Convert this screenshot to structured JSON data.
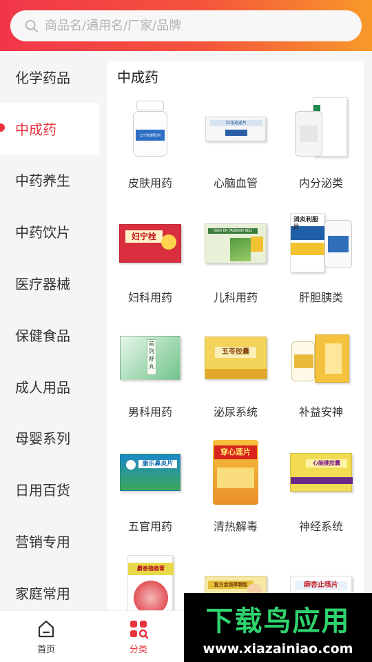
{
  "search": {
    "placeholder": "商品名/通用名/厂家/品牌"
  },
  "sidebar": {
    "items": [
      {
        "label": "化学药品",
        "active": false
      },
      {
        "label": "中成药",
        "active": true
      },
      {
        "label": "中药养生",
        "active": false
      },
      {
        "label": "中药饮片",
        "active": false
      },
      {
        "label": "医疗器械",
        "active": false
      },
      {
        "label": "保健食品",
        "active": false
      },
      {
        "label": "成人用品",
        "active": false
      },
      {
        "label": "母婴系列",
        "active": false
      },
      {
        "label": "日用百货",
        "active": false
      },
      {
        "label": "营销专用",
        "active": false
      },
      {
        "label": "家庭常用",
        "active": false
      }
    ]
  },
  "content": {
    "title": "中成药",
    "categories": [
      {
        "label": "皮肤用药",
        "image_text": "辽宁蛇胆酊剂"
      },
      {
        "label": "心脑血管",
        "image_text": "红花逍遥片"
      },
      {
        "label": "内分泌类",
        "image_text": ""
      },
      {
        "label": "妇科用药",
        "image_text": "妇宁栓"
      },
      {
        "label": "儿科用药",
        "image_text": "XIAO ER YANBIAN KELI"
      },
      {
        "label": "肝胆胰类",
        "image_text": "消炎利胆片"
      },
      {
        "label": "男科用药",
        "image_text": "前列舒丸"
      },
      {
        "label": "泌尿系统",
        "image_text": "五苓胶囊"
      },
      {
        "label": "补益安神",
        "image_text": ""
      },
      {
        "label": "五官用药",
        "image_text": "康乐鼻炎片"
      },
      {
        "label": "清热解毒",
        "image_text": "穿心莲片"
      },
      {
        "label": "神经系统",
        "image_text": "心脑健胶囊"
      },
      {
        "label": "",
        "image_text": "麝香镇痛膏"
      },
      {
        "label": "",
        "image_text": "复方金钱草颗粒"
      },
      {
        "label": "",
        "image_text": "麻杏止咳片"
      }
    ]
  },
  "tabbar": {
    "home": "首页",
    "category": "分类"
  },
  "watermark": {
    "title": "下载鸟应用",
    "url": "www.xiazainiao.com"
  },
  "colors": {
    "accent": "#e8323c",
    "header_start": "#f2364a",
    "header_end": "#f89a2a",
    "watermark_green": "#2fd36e"
  }
}
